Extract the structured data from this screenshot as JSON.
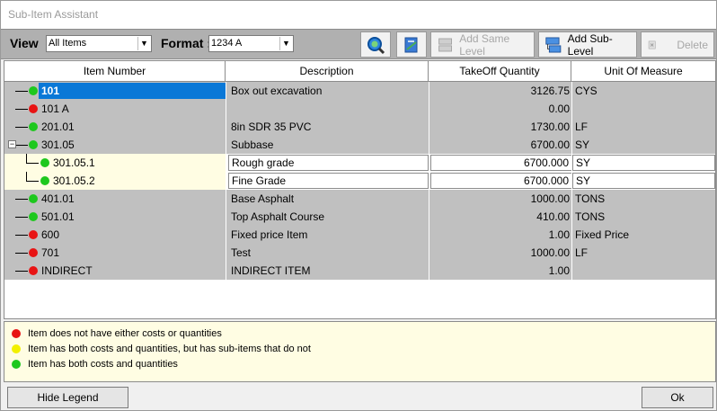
{
  "window": {
    "title": "Sub-Item Assistant"
  },
  "toolbar": {
    "view_label": "View",
    "view_value": "All Items",
    "format_label": "Format :",
    "format_value": "1234 A",
    "add_same_level": "Add Same Level",
    "add_sub_level": "Add Sub-Level",
    "delete": "Delete"
  },
  "grid": {
    "columns": [
      "Item Number",
      "Description",
      "TakeOff Quantity",
      "Unit Of Measure"
    ],
    "rows": [
      {
        "item": "101",
        "status": "green",
        "description": "Box out excavation",
        "qty": "3126.75",
        "uom": "CYS",
        "selected": true
      },
      {
        "item": "101 A",
        "status": "red",
        "description": "",
        "qty": "0.00",
        "uom": ""
      },
      {
        "item": "201.01",
        "status": "green",
        "description": "8in SDR 35 PVC",
        "qty": "1730.00",
        "uom": "LF"
      },
      {
        "item": "301.05",
        "status": "green",
        "description": "Subbase",
        "qty": "6700.00",
        "uom": "SY",
        "expanded": true
      },
      {
        "item": "301.05.1",
        "status": "green",
        "description": "Rough grade",
        "qty": "6700.000",
        "uom": "SY",
        "child": true
      },
      {
        "item": "301.05.2",
        "status": "green",
        "description": "Fine Grade",
        "qty": "6700.000",
        "uom": "SY",
        "child": true
      },
      {
        "item": "401.01",
        "status": "green",
        "description": "Base Asphalt",
        "qty": "1000.00",
        "uom": "TONS"
      },
      {
        "item": "501.01",
        "status": "green",
        "description": "Top Asphalt Course",
        "qty": "410.00",
        "uom": "TONS"
      },
      {
        "item": "600",
        "status": "red",
        "description": "Fixed price Item",
        "qty": "1.00",
        "uom": "Fixed Price"
      },
      {
        "item": "701",
        "status": "red",
        "description": "Test",
        "qty": "1000.00",
        "uom": "LF"
      },
      {
        "item": "INDIRECT",
        "status": "red",
        "description": "INDIRECT ITEM",
        "qty": "1.00",
        "uom": ""
      }
    ]
  },
  "legend": {
    "items": [
      {
        "color": "red",
        "text": "Item does not have either costs or quantities"
      },
      {
        "color": "yellow",
        "text": "Item has both costs and quantities, but has sub-items that do not"
      },
      {
        "color": "green",
        "text": "Item has both costs and quantities"
      }
    ]
  },
  "buttons": {
    "hide_legend": "Hide Legend",
    "ok": "Ok"
  },
  "colors": {
    "selection": "#0a78d7",
    "grid_gray": "#c0c0c0",
    "legend_bg": "#fffde3"
  }
}
